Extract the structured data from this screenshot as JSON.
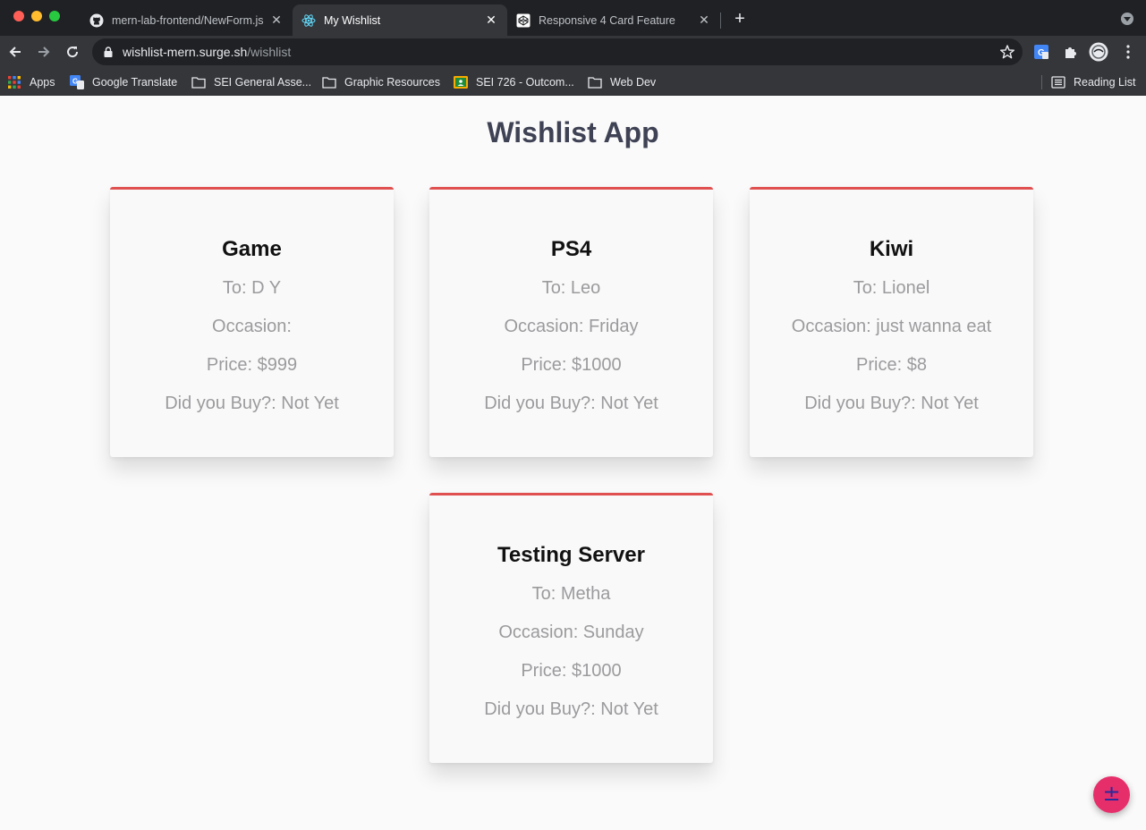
{
  "browser": {
    "tabs": [
      {
        "title": "mern-lab-frontend/NewForm.js",
        "favicon": "github-icon"
      },
      {
        "title": "My Wishlist",
        "favicon": "react-icon",
        "active": true
      },
      {
        "title": "Responsive 4 Card Feature",
        "favicon": "codepen-icon"
      }
    ],
    "url_host": "wishlist-mern.surge.sh",
    "url_path": "/wishlist",
    "bookmarks": {
      "apps": "Apps",
      "google_translate": "Google Translate",
      "sei_general": "SEI General Asse...",
      "graphic_resources": "Graphic Resources",
      "sei_726": "SEI 726 - Outcom...",
      "web_dev": "Web Dev",
      "reading_list": "Reading List"
    }
  },
  "page": {
    "title": "Wishlist App",
    "cards": [
      {
        "name": "Game",
        "to": "To: D Y",
        "occasion": "Occasion:",
        "price": "Price: $999",
        "bought": "Did you Buy?: Not Yet"
      },
      {
        "name": "PS4",
        "to": "To: Leo",
        "occasion": "Occasion: Friday",
        "price": "Price: $1000",
        "bought": "Did you Buy?: Not Yet"
      },
      {
        "name": "Kiwi",
        "to": "To: Lionel",
        "occasion": "Occasion: just wanna eat",
        "price": "Price: $8",
        "bought": "Did you Buy?: Not Yet"
      },
      {
        "name": "Testing Server",
        "to": "To: Metha",
        "occasion": "Occasion: Sunday",
        "price": "Price: $1000",
        "bought": "Did you Buy?: Not Yet"
      }
    ],
    "fab_symbol": "±"
  },
  "colors": {
    "card_accent": "#e05050",
    "fab": "#e62e6b",
    "title": "#3f4254"
  }
}
